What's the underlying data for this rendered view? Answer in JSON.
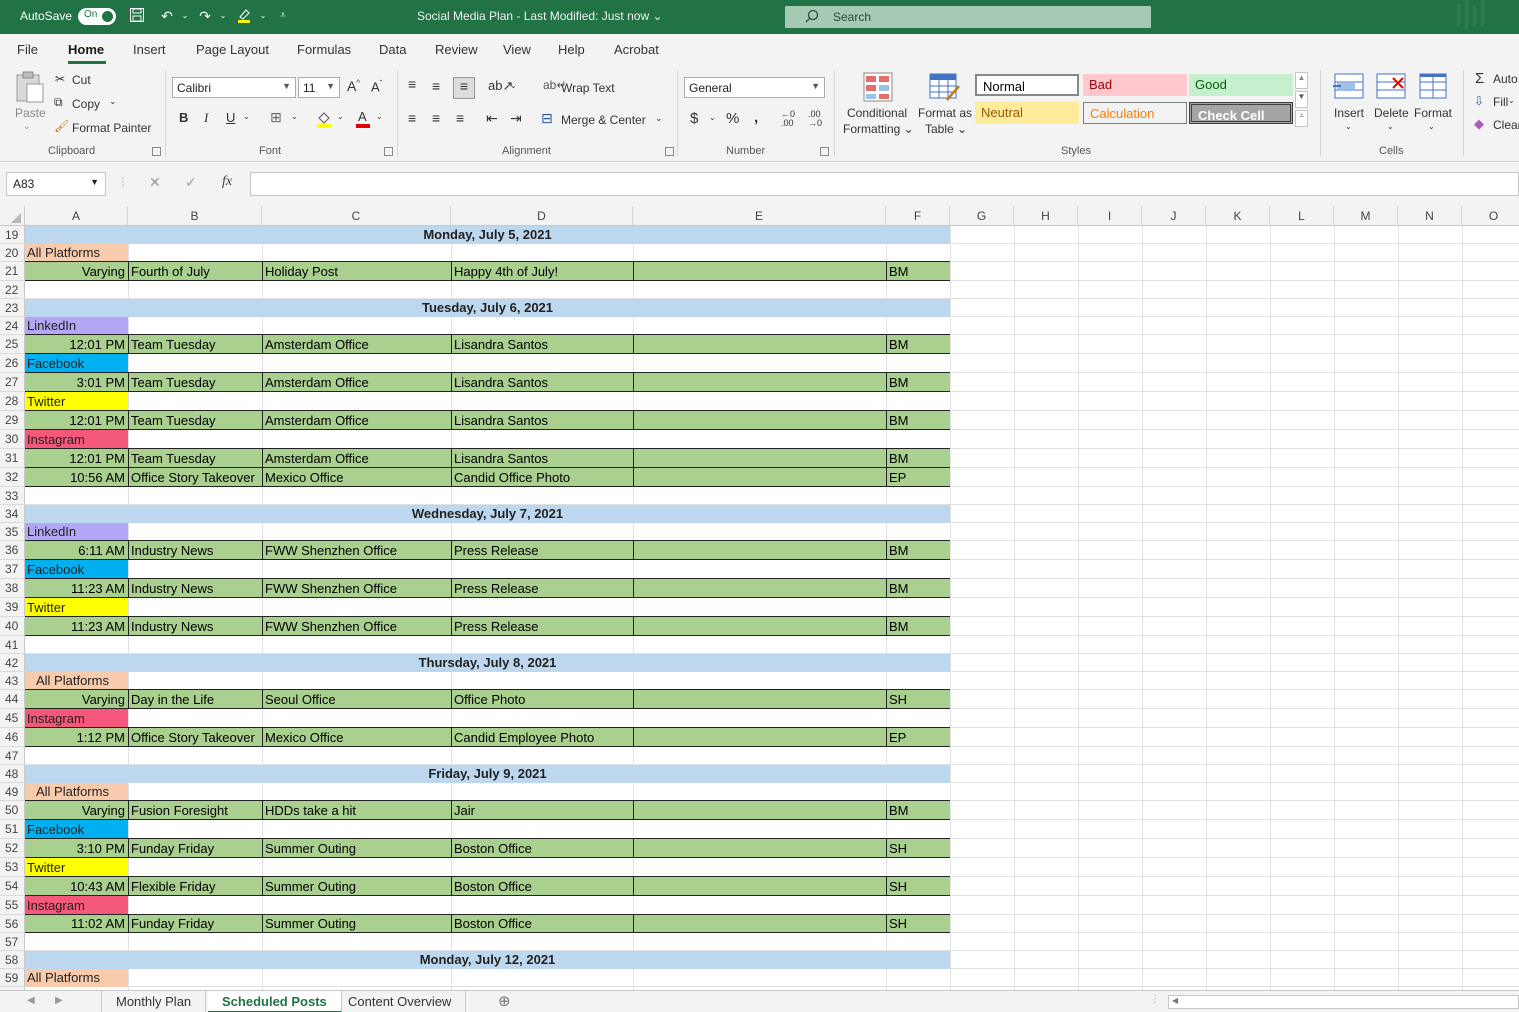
{
  "titlebar": {
    "autosave_label": "AutoSave",
    "autosave_state": "On",
    "document_title": "Social Media Plan  -  Last Modified: Just now  ⌄",
    "search_placeholder": "Search"
  },
  "menu": {
    "tabs": [
      "File",
      "Home",
      "Insert",
      "Page Layout",
      "Formulas",
      "Data",
      "Review",
      "View",
      "Help",
      "Acrobat"
    ],
    "active": "Home"
  },
  "ribbon": {
    "clipboard": {
      "paste": "Paste",
      "cut": "Cut",
      "copy": "Copy",
      "format_painter": "Format Painter",
      "label": "Clipboard"
    },
    "font": {
      "name": "Calibri",
      "size": "11",
      "label": "Font"
    },
    "alignment": {
      "wrap_text": "Wrap Text",
      "merge_center": "Merge & Center",
      "label": "Alignment"
    },
    "number": {
      "format": "General",
      "label": "Number"
    },
    "styles": {
      "conditional_formatting_1": "Conditional",
      "conditional_formatting_2": "Formatting ⌄",
      "format_as_table_1": "Format as",
      "format_as_table_2": "Table ⌄",
      "cell_styles": [
        {
          "name": "Normal",
          "bg": "#ffffff",
          "fg": "#000000"
        },
        {
          "name": "Bad",
          "bg": "#ffc7ce",
          "fg": "#9c0006"
        },
        {
          "name": "Good",
          "bg": "#c6efce",
          "fg": "#006100"
        },
        {
          "name": "Neutral",
          "bg": "#ffeb9c",
          "fg": "#9c5700"
        },
        {
          "name": "Calculation",
          "bg": "#f2f2f2",
          "fg": "#fa7d00"
        },
        {
          "name": "Check Cell",
          "bg": "#a5a5a5",
          "fg": "#ffffff"
        }
      ],
      "label": "Styles"
    },
    "cells": {
      "insert": "Insert",
      "delete": "Delete",
      "format": "Format",
      "label": "Cells"
    },
    "editing": {
      "autosum": "Auto",
      "fill": "Fill",
      "clear": "Clear"
    }
  },
  "formula_bar": {
    "name_box": "A83",
    "fx": "fx",
    "value": ""
  },
  "columns": [
    "A",
    "B",
    "C",
    "D",
    "E",
    "F",
    "G",
    "H",
    "I",
    "J",
    "K",
    "L",
    "M",
    "N",
    "O"
  ],
  "colors": {
    "excel_green": "#217346",
    "row_green": "#a9d08e",
    "date_blue": "#bdd7ee",
    "all_platforms": "#f8cbad",
    "linkedin": "#b4a7f5",
    "facebook": "#00b0f0",
    "twitter": "#ffff00",
    "instagram": "#f4587a"
  },
  "rows": [
    {
      "n": "19",
      "type": "date",
      "text": "Monday, July 5, 2021"
    },
    {
      "n": "20",
      "type": "platform",
      "text": "All Platforms",
      "platform": "all_platforms"
    },
    {
      "n": "21",
      "type": "post",
      "a": "Varying",
      "b": "Fourth of July",
      "c": "Holiday Post",
      "d": "Happy 4th of July!",
      "e": "",
      "f": "BM"
    },
    {
      "n": "22",
      "type": "blank"
    },
    {
      "n": "23",
      "type": "date",
      "text": "Tuesday, July 6, 2021"
    },
    {
      "n": "24",
      "type": "platform",
      "text": "LinkedIn",
      "platform": "linkedin"
    },
    {
      "n": "25",
      "type": "post",
      "a": "12:01 PM",
      "b": "Team Tuesday",
      "c": "Amsterdam Office",
      "d": "Lisandra Santos",
      "e": "",
      "f": "BM"
    },
    {
      "n": "26",
      "type": "platform",
      "text": "Facebook",
      "platform": "facebook"
    },
    {
      "n": "27",
      "type": "post",
      "a": "3:01 PM",
      "b": "Team Tuesday",
      "c": "Amsterdam Office",
      "d": "Lisandra Santos",
      "e": "",
      "f": "BM"
    },
    {
      "n": "28",
      "type": "platform",
      "text": "Twitter",
      "platform": "twitter"
    },
    {
      "n": "29",
      "type": "post",
      "a": "12:01 PM",
      "b": "Team Tuesday",
      "c": "Amsterdam Office",
      "d": "Lisandra Santos",
      "e": "",
      "f": "BM"
    },
    {
      "n": "30",
      "type": "platform",
      "text": "Instagram",
      "platform": "instagram"
    },
    {
      "n": "31",
      "type": "post",
      "a": "12:01 PM",
      "b": "Team Tuesday",
      "c": "Amsterdam Office",
      "d": "Lisandra Santos",
      "e": "",
      "f": "BM"
    },
    {
      "n": "32",
      "type": "post",
      "a": "10:56 AM",
      "b": "Office Story Takeover",
      "c": "Mexico Office",
      "d": "Candid Office Photo",
      "e": "",
      "f": "EP"
    },
    {
      "n": "33",
      "type": "blank"
    },
    {
      "n": "34",
      "type": "date",
      "text": "Wednesday, July 7, 2021"
    },
    {
      "n": "35",
      "type": "platform",
      "text": "LinkedIn",
      "platform": "linkedin"
    },
    {
      "n": "36",
      "type": "post",
      "a": "6:11 AM",
      "b": "Industry News",
      "c": "FWW Shenzhen Office",
      "d": "Press Release",
      "e": "",
      "f": "BM"
    },
    {
      "n": "37",
      "type": "platform",
      "text": "Facebook",
      "platform": "facebook"
    },
    {
      "n": "38",
      "type": "post",
      "a": "11:23 AM",
      "b": "Industry News",
      "c": "FWW Shenzhen Office",
      "d": "Press Release",
      "e": "",
      "f": "BM"
    },
    {
      "n": "39",
      "type": "platform",
      "text": "Twitter",
      "platform": "twitter"
    },
    {
      "n": "40",
      "type": "post",
      "a": "11:23 AM",
      "b": "Industry News",
      "c": "FWW Shenzhen Office",
      "d": "Press Release",
      "e": "",
      "f": "BM"
    },
    {
      "n": "41",
      "type": "blank"
    },
    {
      "n": "42",
      "type": "date",
      "text": "Thursday, July 8, 2021"
    },
    {
      "n": "43",
      "type": "platform",
      "text": "All Platforms",
      "platform": "all_platforms",
      "indent": true
    },
    {
      "n": "44",
      "type": "post",
      "a": "Varying",
      "b": "Day in the Life",
      "c": "Seoul Office",
      "d": "Office Photo",
      "e": "",
      "f": "SH"
    },
    {
      "n": "45",
      "type": "platform",
      "text": "Instagram",
      "platform": "instagram"
    },
    {
      "n": "46",
      "type": "post",
      "a": "1:12 PM",
      "b": "Office Story Takeover",
      "c": "Mexico Office",
      "d": "Candid Employee Photo",
      "e": "",
      "f": "EP"
    },
    {
      "n": "47",
      "type": "blank"
    },
    {
      "n": "48",
      "type": "date",
      "text": "Friday, July 9, 2021"
    },
    {
      "n": "49",
      "type": "platform",
      "text": "All Platforms",
      "platform": "all_platforms",
      "indent": true
    },
    {
      "n": "50",
      "type": "post",
      "a": "Varying",
      "b": "Fusion Foresight",
      "c": "HDDs take a hit",
      "d": "Jair",
      "e": "",
      "f": "BM"
    },
    {
      "n": "51",
      "type": "platform",
      "text": "Facebook",
      "platform": "facebook"
    },
    {
      "n": "52",
      "type": "post",
      "a": "3:10 PM",
      "b": "Funday Friday",
      "c": "Summer Outing",
      "d": "Boston Office",
      "e": "",
      "f": "SH"
    },
    {
      "n": "53",
      "type": "platform",
      "text": "Twitter",
      "platform": "twitter"
    },
    {
      "n": "54",
      "type": "post",
      "a": "10:43 AM",
      "b": "Flexible Friday",
      "c": "Summer Outing",
      "d": "Boston Office",
      "e": "",
      "f": "SH"
    },
    {
      "n": "55",
      "type": "platform",
      "text": "Instagram",
      "platform": "instagram"
    },
    {
      "n": "56",
      "type": "post",
      "a": "11:02 AM",
      "b": "Funday Friday",
      "c": "Summer Outing",
      "d": "Boston Office",
      "e": "",
      "f": "SH"
    },
    {
      "n": "57",
      "type": "blank"
    },
    {
      "n": "58",
      "type": "date",
      "text": "Monday, July 12, 2021"
    },
    {
      "n": "59",
      "type": "platform",
      "text": "All Platforms",
      "platform": "all_platforms"
    }
  ],
  "sheet_tabs": [
    {
      "label": "Monthly Plan",
      "active": false
    },
    {
      "label": "Scheduled Posts",
      "active": true
    },
    {
      "label": "Content Overview",
      "active": false
    }
  ]
}
